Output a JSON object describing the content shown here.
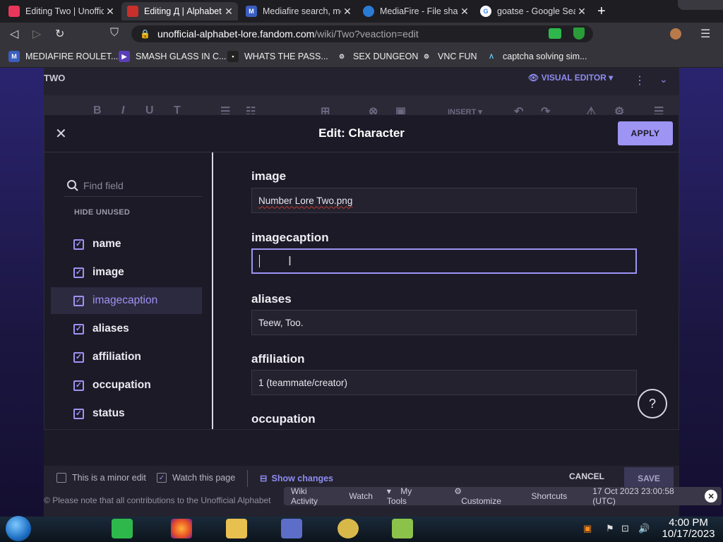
{
  "browser": {
    "tabs": [
      {
        "title": "Editing Two | Unoffic",
        "active": false,
        "favicon_color": "#e8375a"
      },
      {
        "title": "Editing Д | Alphabet",
        "active": true,
        "favicon_color": "#c9302c"
      },
      {
        "title": "Mediafire search, me",
        "active": false,
        "favicon_color": "#3b5fc0"
      },
      {
        "title": "MediaFire - File shari",
        "active": false,
        "favicon_color": "#2a7bd4"
      },
      {
        "title": "goatse - Google Sea",
        "active": false,
        "favicon_color": "#ffffff"
      }
    ],
    "url_host": "unofficial-alphabet-lore.fandom.com",
    "url_path": "/wiki/Two?veaction=edit",
    "bookmarks": [
      {
        "label": "MEDIAFIRE ROULET...",
        "icon": "mediafire-icon"
      },
      {
        "label": "SMASH GLASS IN C...",
        "icon": "visual-studio-icon"
      },
      {
        "label": "WHATS THE PASS...",
        "icon": "document-icon"
      },
      {
        "label": "SEX DUNGEON",
        "icon": "gear-icon"
      },
      {
        "label": "VNC FUN",
        "icon": "gear-icon"
      },
      {
        "label": "captcha solving sim...",
        "icon": "triangle-logo-icon"
      }
    ]
  },
  "editor": {
    "page_title": "TWO",
    "visual_editor_label": "VISUAL EDITOR",
    "insert_label": "INSERT"
  },
  "dialog": {
    "title": "Edit: Character",
    "apply_label": "APPLY",
    "search_placeholder": "Find field",
    "hide_unused_label": "HIDE UNUSED",
    "field_list": [
      "name",
      "image",
      "imagecaption",
      "aliases",
      "affiliation",
      "occupation",
      "status"
    ],
    "selected_field": "imagecaption",
    "fields": [
      {
        "label": "image",
        "value": "Number Lore Two.png"
      },
      {
        "label": "imagecaption",
        "value": ""
      },
      {
        "label": "aliases",
        "value": "Teew, Too."
      },
      {
        "label": "affiliation",
        "value": "1 (teammate/creator)"
      },
      {
        "label": "occupation",
        "value": ""
      }
    ],
    "help_label": "?"
  },
  "save_bar": {
    "minor_edit_label": "This is a minor edit",
    "watch_label": "Watch this page",
    "show_changes_label": "Show changes",
    "cancel_label": "CANCEL",
    "save_label": "SAVE",
    "notice": "Please note that all contributions to the Unofficial Alphabet"
  },
  "wiki_toolbar": {
    "items": [
      "Wiki Activity",
      "Watch",
      "My Tools",
      "Customize",
      "Shortcuts"
    ],
    "timestamp": "17 Oct 2023 23:00:58 (UTC)"
  },
  "taskbar": {
    "time": "4:00 PM",
    "date": "10/17/2023"
  },
  "colors": {
    "accent": "#9d94f3",
    "dialog_bg": "#1c1a27"
  }
}
